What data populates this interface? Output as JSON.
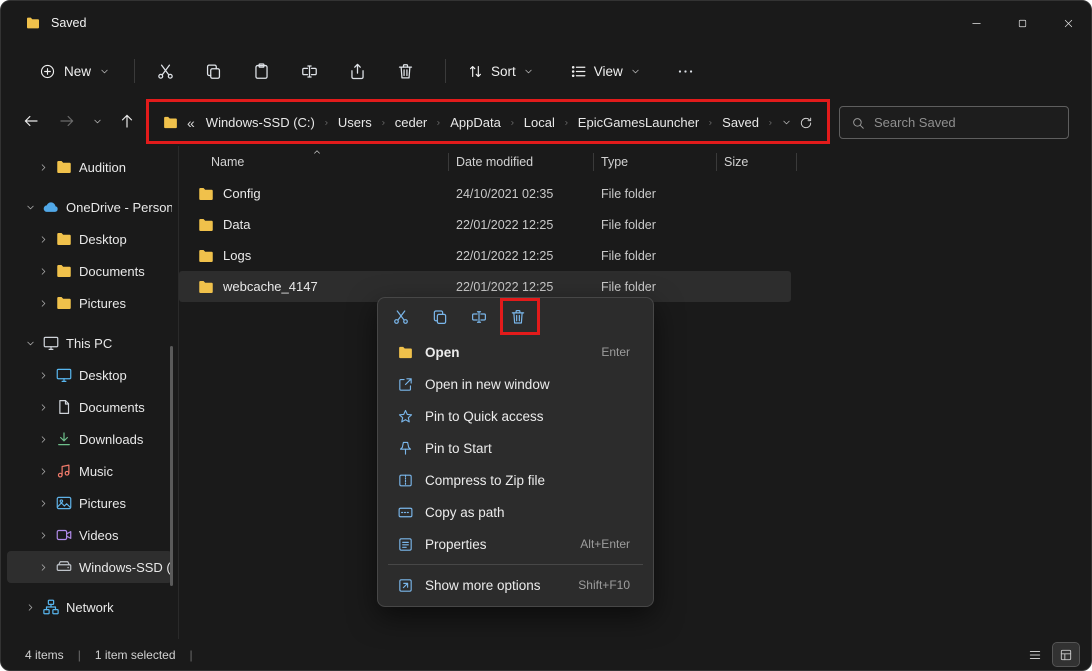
{
  "colors": {
    "annotation": "#e21b1b",
    "folder": "#f0c14b",
    "onedrive": "#51a8e8",
    "menu_icon": "#7ab6ea"
  },
  "titlebar": {
    "title": "Saved"
  },
  "toolbar": {
    "new_label": "New",
    "sort_label": "Sort",
    "view_label": "View"
  },
  "address": {
    "collapse": "«",
    "segments": [
      "Windows-SSD (C:)",
      "Users",
      "ceder",
      "AppData",
      "Local",
      "EpicGamesLauncher",
      "Saved"
    ]
  },
  "search": {
    "placeholder": "Search Saved"
  },
  "sidebar": {
    "items": [
      {
        "label": "Audition"
      },
      {
        "label": "OneDrive - Personal"
      },
      {
        "label": "Desktop"
      },
      {
        "label": "Documents"
      },
      {
        "label": "Pictures"
      },
      {
        "label": "This PC"
      },
      {
        "label": "Desktop"
      },
      {
        "label": "Documents"
      },
      {
        "label": "Downloads"
      },
      {
        "label": "Music"
      },
      {
        "label": "Pictures"
      },
      {
        "label": "Videos"
      },
      {
        "label": "Windows-SSD (C:)"
      },
      {
        "label": "Network"
      }
    ]
  },
  "files": {
    "columns": {
      "name": "Name",
      "date": "Date modified",
      "type": "Type",
      "size": "Size"
    },
    "rows": [
      {
        "name": "Config",
        "date": "24/10/2021 02:35",
        "type": "File folder",
        "size": ""
      },
      {
        "name": "Data",
        "date": "22/01/2022 12:25",
        "type": "File folder",
        "size": ""
      },
      {
        "name": "Logs",
        "date": "22/01/2022 12:25",
        "type": "File folder",
        "size": ""
      },
      {
        "name": "webcache_4147",
        "date": "22/01/2022 12:25",
        "type": "File folder",
        "size": ""
      }
    ]
  },
  "context_menu": {
    "items": [
      {
        "label": "Open",
        "shortcut": "Enter"
      },
      {
        "label": "Open in new window",
        "shortcut": ""
      },
      {
        "label": "Pin to Quick access",
        "shortcut": ""
      },
      {
        "label": "Pin to Start",
        "shortcut": ""
      },
      {
        "label": "Compress to Zip file",
        "shortcut": ""
      },
      {
        "label": "Copy as path",
        "shortcut": ""
      },
      {
        "label": "Properties",
        "shortcut": "Alt+Enter"
      },
      {
        "label": "Show more options",
        "shortcut": "Shift+F10"
      }
    ]
  },
  "status": {
    "count": "4 items",
    "selected": "1 item selected",
    "sep": "|"
  }
}
